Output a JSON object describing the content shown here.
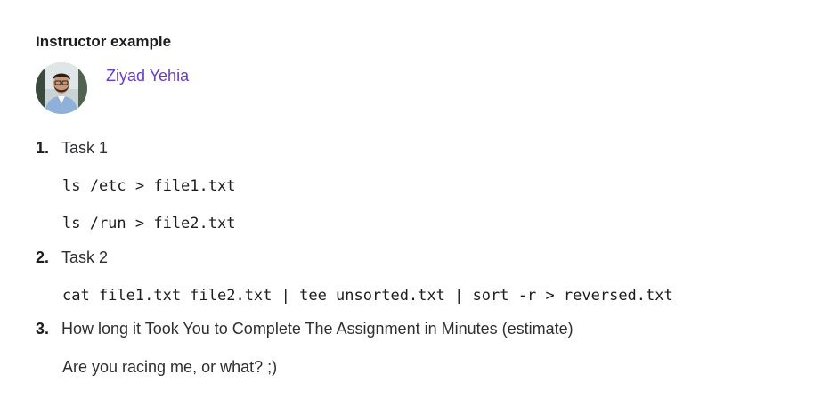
{
  "section": {
    "title": "Instructor example"
  },
  "instructor": {
    "name": "Ziyad Yehia",
    "avatar_icon": "avatar-photo"
  },
  "colors": {
    "link": "#6a3bd1",
    "heading": "#1c1d1f",
    "text": "#2d2f31"
  },
  "tasks": [
    {
      "number": "1.",
      "label": "Task 1",
      "lines": [
        "ls /etc > file1.txt",
        "ls /run > file2.txt"
      ]
    },
    {
      "number": "2.",
      "label": "Task 2",
      "lines": [
        "cat file1.txt file2.txt | tee unsorted.txt | sort -r > reversed.txt"
      ]
    },
    {
      "number": "3.",
      "label": "How long it Took You to Complete The Assignment in Minutes (estimate)",
      "answer": "Are you racing me, or what? ;)"
    }
  ]
}
